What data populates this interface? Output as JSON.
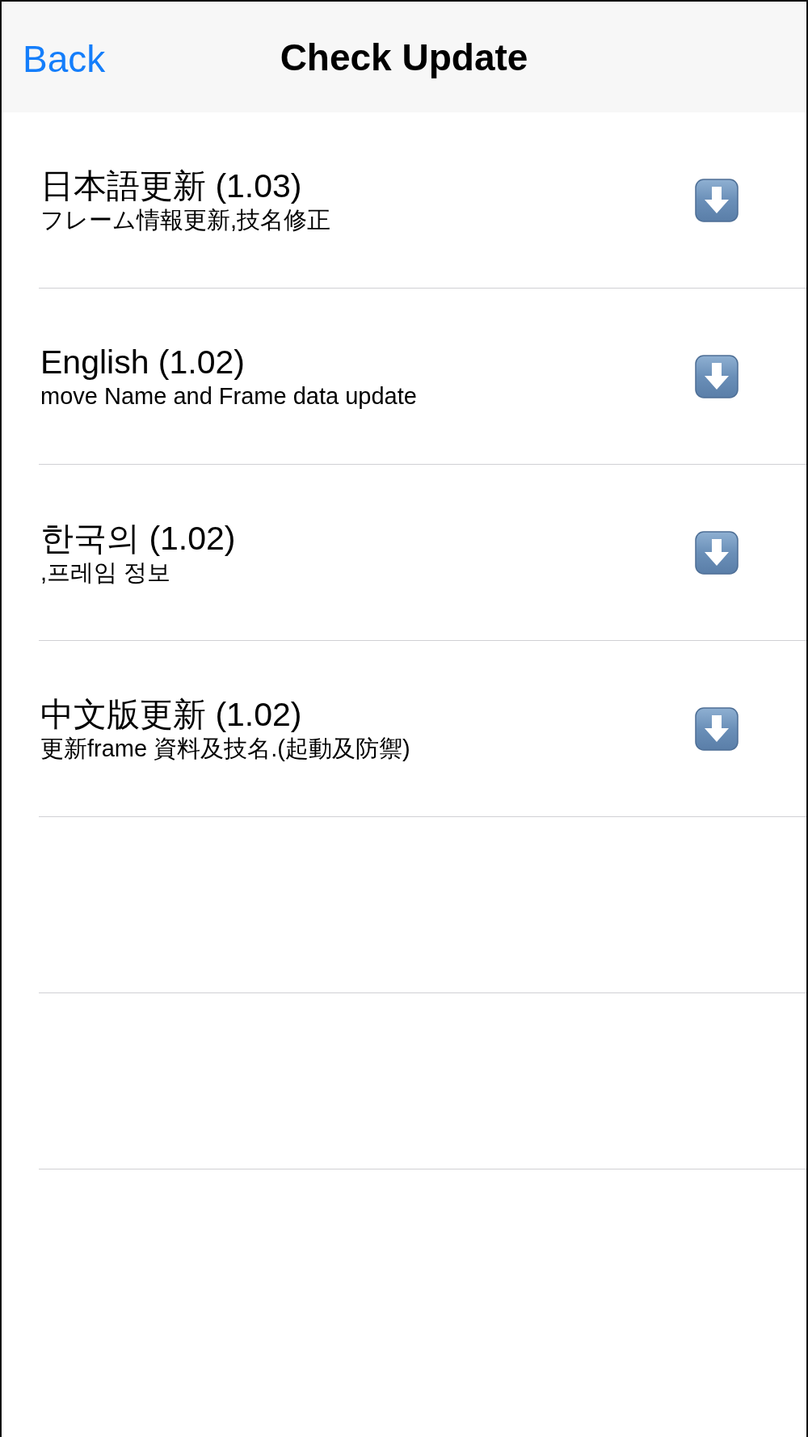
{
  "nav_bar": {
    "back": "Back",
    "title": "Check Update"
  },
  "updates": [
    {
      "title": "日本語更新 (1.03)",
      "description": "フレーム情報更新,技名修正"
    },
    {
      "title": "English (1.02)",
      "description": "move Name and Frame data update"
    },
    {
      "title": "한국의 (1.02)",
      "description": ",프레임 정보"
    },
    {
      "title": "中文版更新 (1.02)",
      "description": "更新frame 資料及技名.(起動及防禦)"
    }
  ]
}
